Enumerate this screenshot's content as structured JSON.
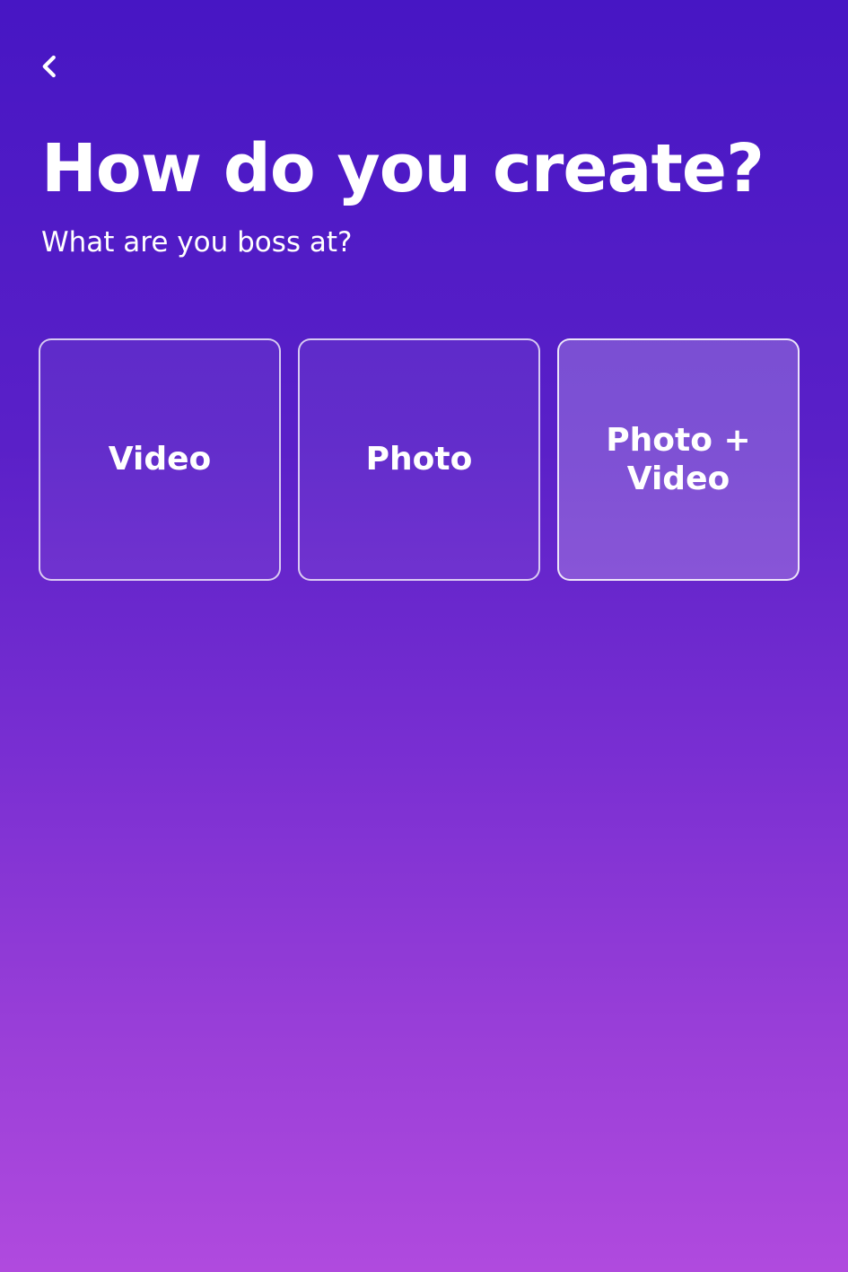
{
  "header": {
    "back_icon": "chevron-left-icon",
    "title": "How do you create?",
    "subtitle": "What are you boss at?"
  },
  "options": [
    {
      "label": "Video",
      "selected": false
    },
    {
      "label": "Photo",
      "selected": false
    },
    {
      "label": "Photo +\nVideo",
      "selected": true
    }
  ],
  "colors": {
    "gradient_top": "#4716c4",
    "gradient_bottom": "#b04ade",
    "text": "#ffffff"
  }
}
